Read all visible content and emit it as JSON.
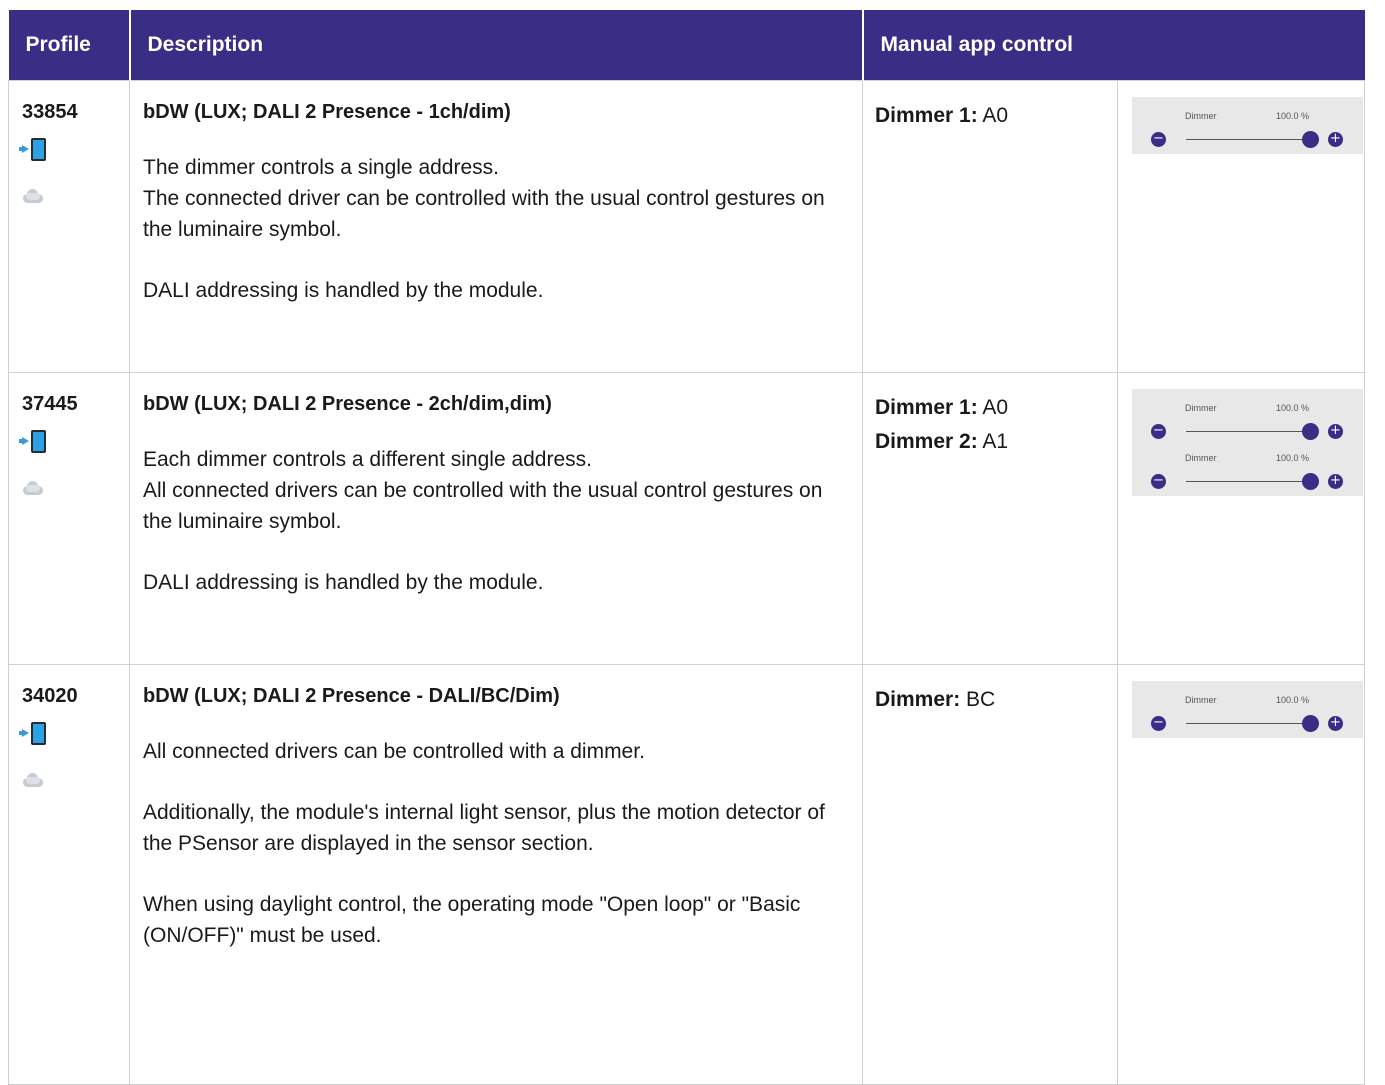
{
  "header": {
    "profile": "Profile",
    "description": "Description",
    "manual_app_control": "Manual app control"
  },
  "rows": [
    {
      "id": "33854",
      "title": "bDW (LUX; DALI 2 Presence - 1ch/dim)",
      "paragraphs": [
        "The dimmer controls a single address.\nThe connected driver can be controlled with the usual control gestures on the luminaire symbol.",
        "DALI addressing is handled by the module."
      ],
      "mapping": [
        {
          "key": "Dimmer 1:",
          "value": "A0"
        }
      ],
      "sliders": [
        {
          "label": "Dimmer",
          "value": "100.0 %"
        }
      ]
    },
    {
      "id": "37445",
      "title": "bDW (LUX; DALI 2 Presence - 2ch/dim,dim)",
      "paragraphs": [
        "Each dimmer controls a different single address.\nAll connected drivers can be controlled with the usual control gestures on the luminaire symbol.",
        "DALI addressing is handled by the module."
      ],
      "mapping": [
        {
          "key": "Dimmer 1:",
          "value": "A0"
        },
        {
          "key": "Dimmer 2:",
          "value": "A1"
        }
      ],
      "sliders": [
        {
          "label": "Dimmer",
          "value": "100.0 %"
        },
        {
          "label": "Dimmer",
          "value": "100.0 %"
        }
      ]
    },
    {
      "id": "34020",
      "title": "bDW (LUX; DALI 2 Presence - DALI/BC/Dim)",
      "paragraphs": [
        "All connected drivers can be controlled with a dimmer.",
        "Additionally, the module's internal light sensor, plus the motion detector of the PSensor are displayed in the sensor section.",
        "When using daylight control, the operating mode \"Open loop\" or \"Basic (ON/OFF)\" must be used."
      ],
      "mapping": [
        {
          "key": "Dimmer:",
          "value": "BC"
        }
      ],
      "sliders": [
        {
          "label": "Dimmer",
          "value": "100.0 %"
        }
      ]
    }
  ],
  "colors": {
    "header_bg": "#3a2d85",
    "accent": "#3a2d85"
  },
  "icons": [
    "phone-app-icon",
    "cloud-icon",
    "minus-icon",
    "plus-icon"
  ]
}
